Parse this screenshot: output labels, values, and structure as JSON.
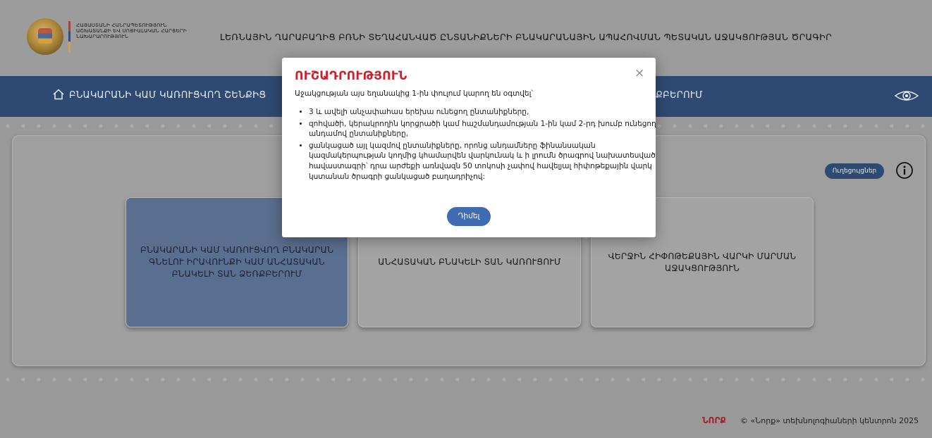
{
  "header": {
    "ministry_name": "ՀԱՅԱՍՏԱՆԻ ՀԱՆՐԱՊԵՏՈՒԹՅՈՒՆ ԱՇԽԱՏԱՆՔԻ ԵՎ ՍՈՑԻԱԼԱԿԱՆ ՀԱՐՑԵՐԻ ՆԱԽԱՐԱՐՈՒԹՅՈՒՆ",
    "program_title": "ԼԵՌՆԱՅԻՆ ՂԱՐԱԲԱՂԻՑ ԲՌՆԻ ՏԵՂԱՀԱՆՎԱԾ ԸՆՏԱՆԻՔՆԵՐԻ ԲՆԱԿԱՐԱՆԱՅԻՆ ԱՊԱՀՈՎՄԱՆ ՊԵՏԱԿԱՆ ԱՋԱԿՑՈՒԹՅԱՆ ԾՐԱԳԻՐ"
  },
  "nav": {
    "left_label": "ԲՆԱԿԱՐԱՆԻ ԿԱՄ ԿԱՌՈՒՑՎՈՂ ՇԵՆՔԻՑ",
    "right_label": "ՔԲԵՐՈՒՄ"
  },
  "toolbar": {
    "instructions_label": "Ուղեցույցներ"
  },
  "cards": [
    "ԲՆԱԿԱՐԱՆԻ ԿԱՄ ԿԱՌՈՒՑՎՈՂ ԲՆԱԿԱՐԱՆ ԳՆԵԼՈՒ ԻՐԱՎՈՒՆՔԻ ԿԱՄ ԱՆՀԱՏԱԿԱՆ ԲՆԱԿԵԼԻ ՏԱՆ ՁԵՌՔԲԵՐՈՒՄ",
    "ԱՆՀԱՏԱԿԱՆ ԲՆԱԿԵԼԻ ՏԱՆ ԿԱՌՈՒՑՈՒՄ",
    "ՎԵՐՋԻՆ ՀԻՓՈԹԵՔԱՅԻՆ ՎԱՐԿԻ ՄԱՐՄԱՆ ԱՋԱԿՑՈՒԹՅՈՒՆ"
  ],
  "modal": {
    "title": "ՈՒՇԱԴՐՈՒԹՅՈՒՆ",
    "close": "×",
    "intro": "Աջակցության այս եղանակից 1-ին փուլում կարող են օգտվել՝",
    "items": [
      "3 և ավելի անչափահաս երեխա ունեցող ընտանիքները,",
      "զոհվածի, կերակրողին կորցրածի կամ հաշմանդամության 1-ին կամ 2-րդ խումբ ունեցող անդամով ընտանիքները,",
      "ցանկացած այլ կազմով ընտանիքները, որոնց անդամները ֆինանսական կազմակերպության կողմից կհամարվեն վարկունակ և ի լրումն ծրագրով նախատեսված հավաստագրի՝ դրա արժեքի առնվազն 50 տոկոսի չափով հավելյալ հիփոթեքային վարկ կստանան ծրագրի ցանկացած բաղադրիչով:"
    ],
    "button_label": "Դիմել"
  },
  "footer": {
    "logo_text": "ՆՈՐՔ",
    "copyright": "© «Նորք» տեխնոլոգիաների կենտրոն 2025"
  },
  "colors": {
    "navbar": "#2f4a72",
    "modal_title": "#d11f2a",
    "primary_button": "#3f6bb0",
    "active_card": "#5a6e8f",
    "footer_logo": "#a4202c"
  }
}
